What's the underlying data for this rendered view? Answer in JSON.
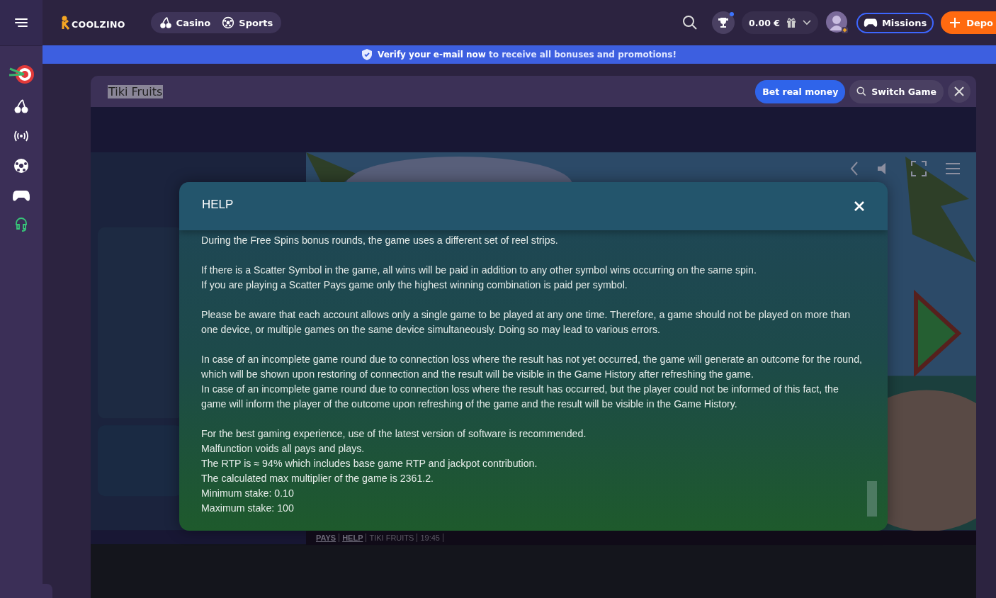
{
  "header": {
    "logo": "COOLZINO",
    "nav": [
      {
        "label": "Casino",
        "kind": "casino"
      },
      {
        "label": "Sports",
        "kind": "sports"
      }
    ],
    "balance": "0.00 €",
    "missions": "Missions",
    "deposit": "Depo"
  },
  "banner": {
    "text": "**Verify your e-mail now** to receive all bonuses and promotions!"
  },
  "game_bar": {
    "title": "Tiki Fruits",
    "bet_button": "Bet real money",
    "switch_button": "Switch Game"
  },
  "help_dialog": {
    "title": "HELP",
    "paragraphs": [
      [
        "During the Free Spins bonus rounds, the game uses a different set of reel strips."
      ],
      [
        "If there is a Scatter Symbol in the game, all wins will be paid in addition to any other symbol wins occurring on the same spin.",
        "If you are playing a Scatter Pays game only the highest winning combination is paid per symbol."
      ],
      [
        "Please be aware that each account allows only a single game to be played at any one time. Therefore, a game should not be played on more than",
        "one device, or multiple games on the same device simultaneously. Doing so may lead to various errors."
      ],
      [
        "In case of an incomplete game round due to connection loss where the result has not yet occurred, the game will generate an outcome for the round,",
        "which will be shown upon restoring of connection and the result will be visible in the Game History after refreshing the game.",
        "In case of an incomplete game round due to connection loss where the result has occurred, but the player could not be informed of this fact, the",
        "game will inform the player of the outcome upon refreshing of the game and the result will be visible in the Game History."
      ],
      [
        "For the best gaming experience, use of the latest version of software is recommended.",
        "Malfunction voids all pays and plays.",
        "The RTP is ≈ 94% which includes base game RTP and jackpot contribution.",
        "The calculated max multiplier of the game is 2361.2.",
        "Minimum stake: 0.10",
        "Maximum stake: 100"
      ]
    ]
  },
  "game_footer": [
    {
      "label": "PAYS",
      "kind": "link"
    },
    {
      "label": "HELP",
      "kind": "link"
    },
    {
      "label": "TIKI FRUITS",
      "kind": "text"
    },
    {
      "label": "19:45",
      "kind": "text"
    }
  ]
}
